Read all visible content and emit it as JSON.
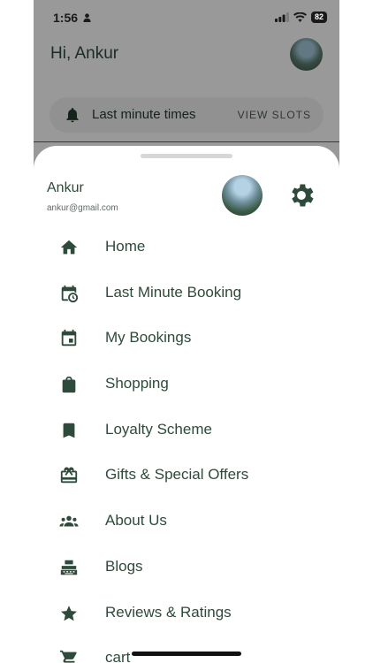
{
  "status_bar": {
    "time": "1:56",
    "battery": "82"
  },
  "background": {
    "greeting": "Hi, Ankur",
    "promo": {
      "text": "Last minute times",
      "action": "VIEW SLOTS"
    }
  },
  "drawer": {
    "user": {
      "name": "Ankur",
      "email": "ankur@gmail.com"
    },
    "menu": [
      {
        "label": "Home",
        "icon": "home-icon"
      },
      {
        "label": "Last Minute Booking",
        "icon": "calendar-clock-icon"
      },
      {
        "label": "My Bookings",
        "icon": "calendar-icon"
      },
      {
        "label": "Shopping",
        "icon": "shopping-bag-icon"
      },
      {
        "label": "Loyalty Scheme",
        "icon": "bookmark-icon"
      },
      {
        "label": "Gifts & Special Offers",
        "icon": "gift-card-icon"
      },
      {
        "label": "About Us",
        "icon": "group-icon"
      },
      {
        "label": "Blogs",
        "icon": "typewriter-icon"
      },
      {
        "label": "Reviews & Ratings",
        "icon": "star-icon"
      },
      {
        "label": "cart",
        "icon": "cart-icon"
      }
    ]
  },
  "colors": {
    "accent": "#2e4a3a",
    "scrim": "rgba(0,0,0,0.38)"
  }
}
